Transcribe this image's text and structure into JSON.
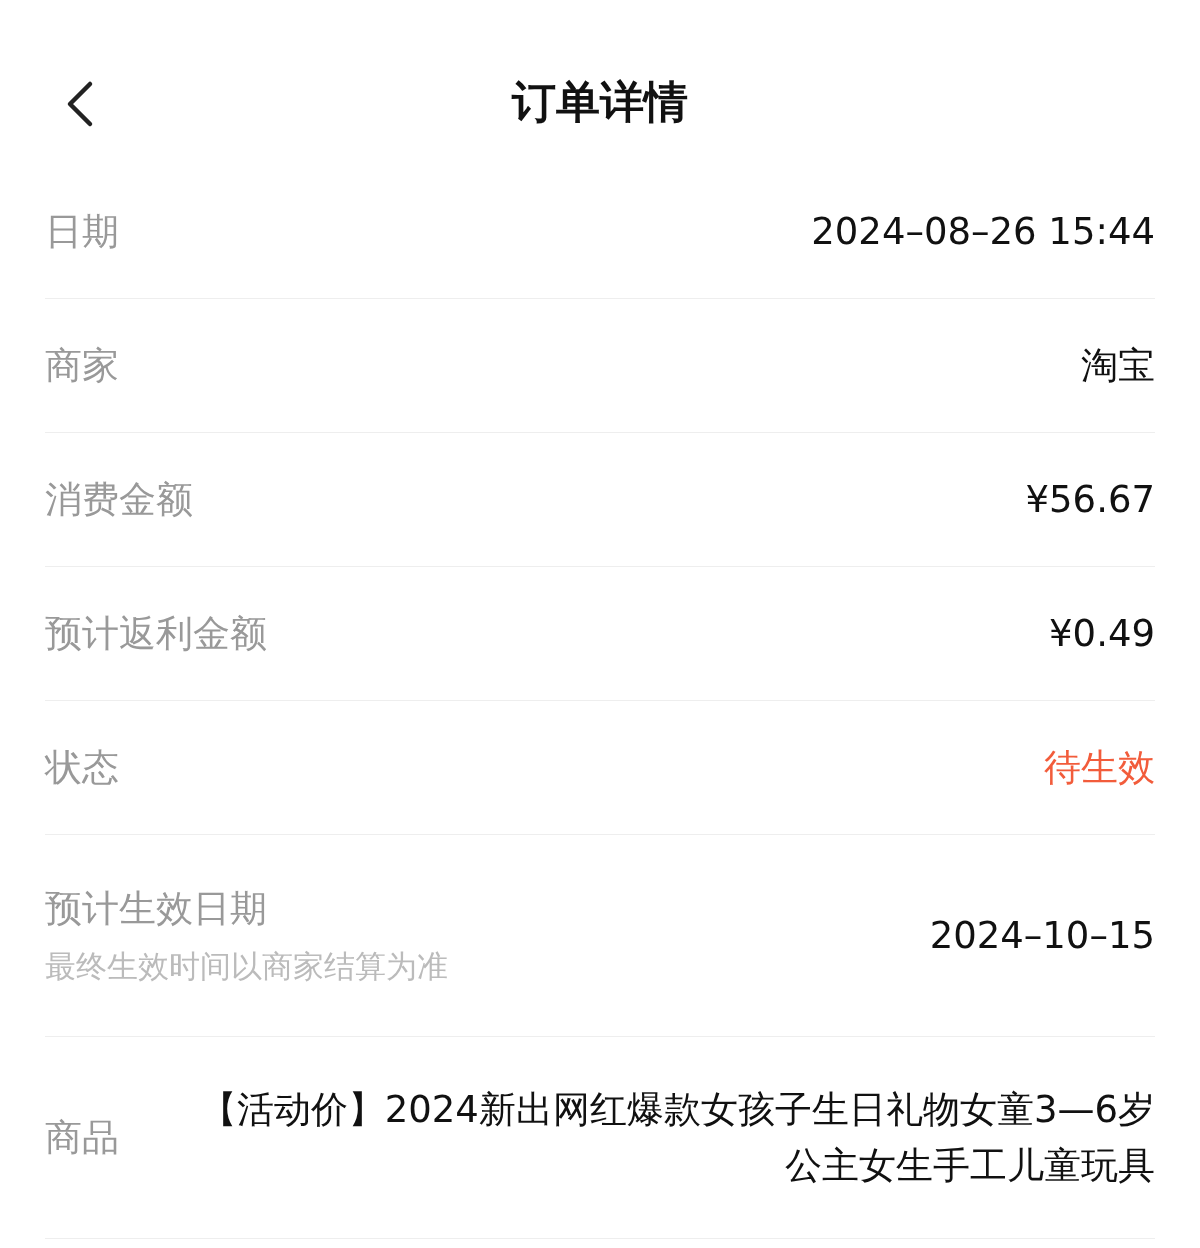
{
  "header": {
    "title": "订单详情"
  },
  "rows": [
    {
      "kind": "plain",
      "label": "日期",
      "value": "2024–08–26 15:44"
    },
    {
      "kind": "plain",
      "label": "商家",
      "value": "淘宝"
    },
    {
      "kind": "plain",
      "label": "消费金额",
      "value": "¥56.67"
    },
    {
      "kind": "plain",
      "label": "预计返利金额",
      "value": "¥0.49"
    },
    {
      "kind": "status",
      "label": "状态",
      "value": "待生效"
    },
    {
      "kind": "note",
      "label": "预计生效日期",
      "note": "最终生效时间以商家结算为准",
      "value": "2024–10–15"
    },
    {
      "kind": "product",
      "label": "商品",
      "value": "【活动价】2024新出网红爆款女孩子生日礼物女童3—6岁公主女生手工儿童玩具"
    }
  ]
}
